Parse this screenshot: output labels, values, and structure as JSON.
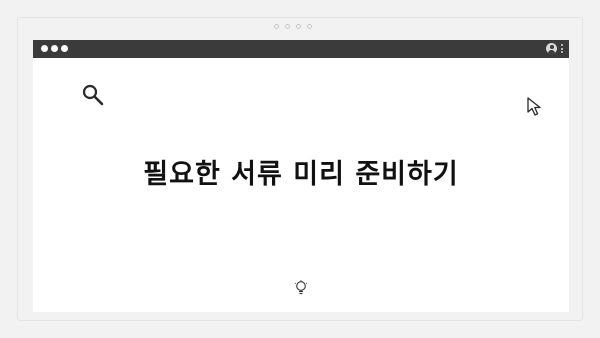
{
  "content": {
    "headline": "필요한 서류 미리 준비하기"
  },
  "icons": {
    "search": "search-icon",
    "cursor": "cursor-arrow-icon",
    "bulb": "lightbulb-icon",
    "user": "user-icon",
    "menu": "kebab-menu-icon"
  },
  "colors": {
    "titlebar": "#3b3b3b",
    "page_background": "#ffffff",
    "frame_background": "#f2f2f2",
    "text": "#111111"
  }
}
